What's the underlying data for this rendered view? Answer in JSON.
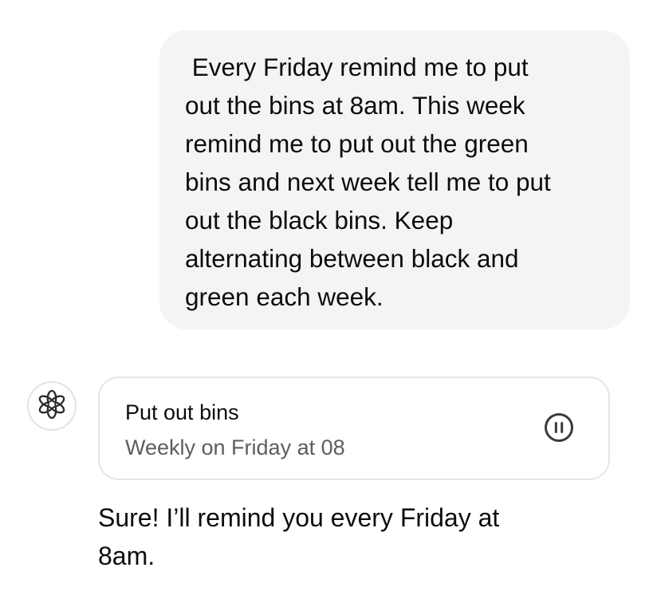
{
  "user_message": {
    "text": " Every Friday remind me to put\nout the bins at 8am. This week\nremind me to put out the green\nbins and next week tell me to put\nout the black bins. Keep\nalternating between black and\ngreen each week."
  },
  "assistant": {
    "avatar_icon": "openai-logo-icon",
    "task_card": {
      "title": "Put out bins",
      "schedule": "Weekly on Friday at 08",
      "pause_icon": "pause-circle-icon"
    },
    "reply_text": "Sure! I’ll remind you every Friday at\n8am."
  },
  "colors": {
    "bubble_bg": "#f3f4f6",
    "card_border": "#e5e5e5",
    "secondary_text": "#5d5d5d",
    "icon": "#3a3a3a"
  }
}
